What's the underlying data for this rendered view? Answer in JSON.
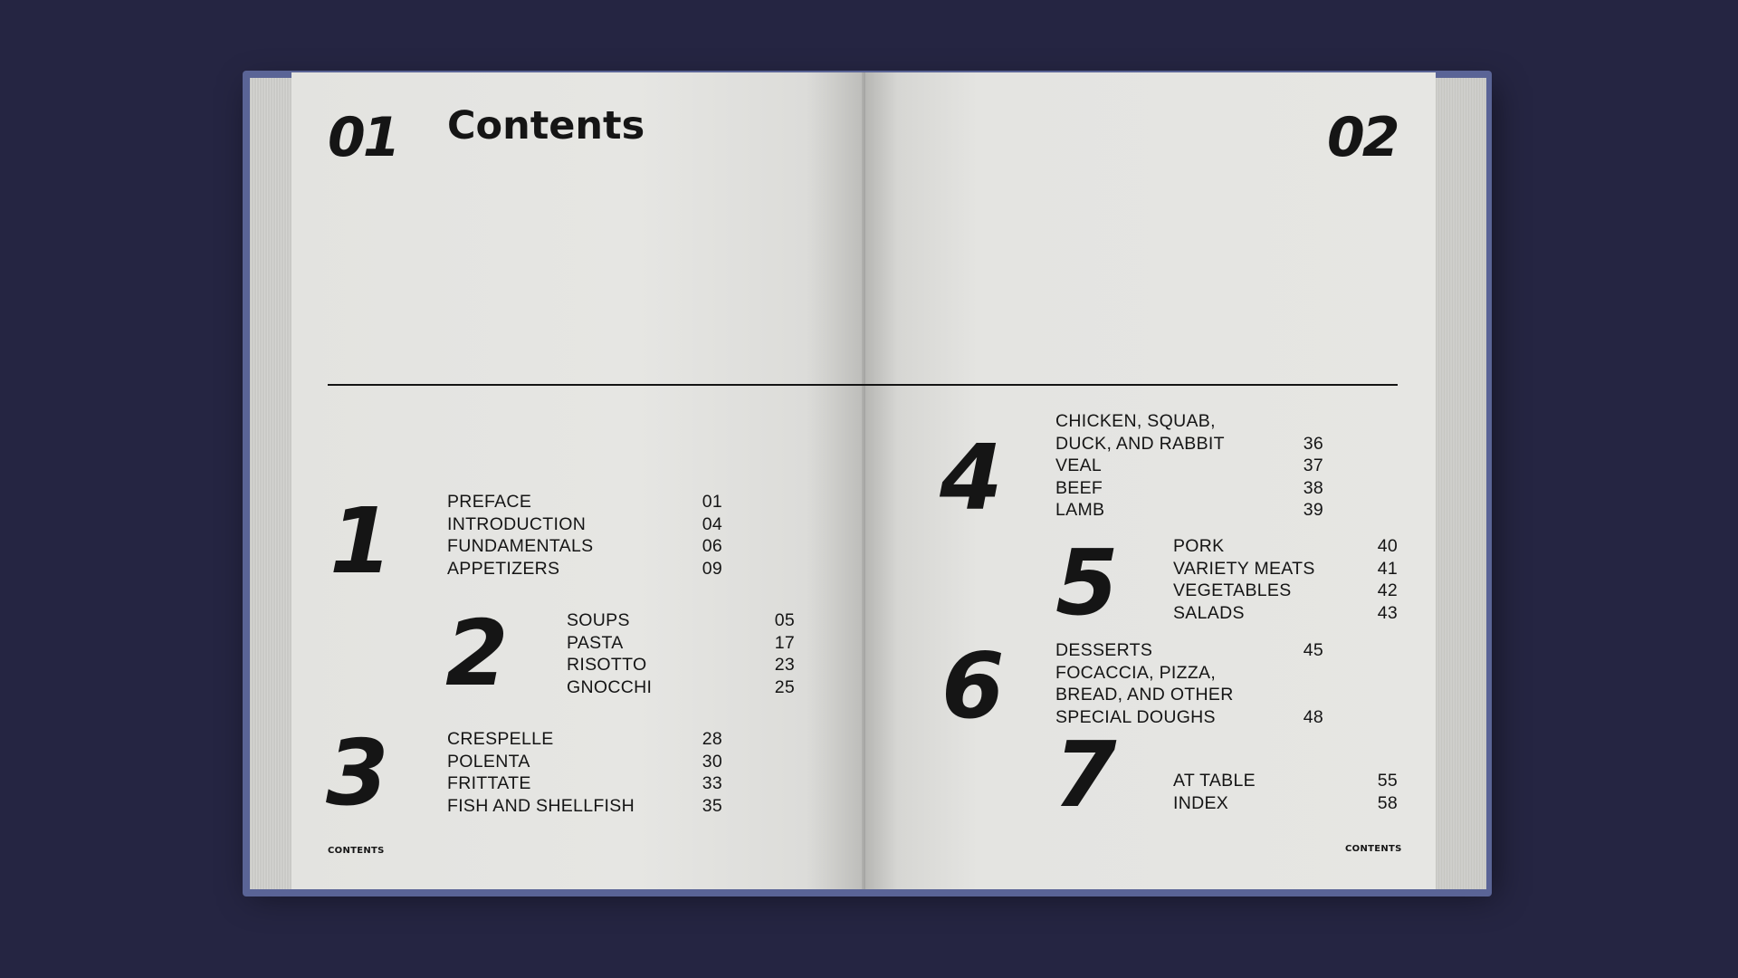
{
  "left_page": {
    "page_number": "01",
    "title": "Contents",
    "footer": "CONTENTS",
    "sections": [
      {
        "number": "1",
        "entries": [
          {
            "label": "PREFACE",
            "page": "01"
          },
          {
            "label": "INTRODUCTION",
            "page": "04"
          },
          {
            "label": "FUNDAMENTALS",
            "page": "06"
          },
          {
            "label": "APPETIZERS",
            "page": "09"
          }
        ]
      },
      {
        "number": "2",
        "entries": [
          {
            "label": "SOUPS",
            "page": "05"
          },
          {
            "label": "PASTA",
            "page": "17"
          },
          {
            "label": "RISOTTO",
            "page": "23"
          },
          {
            "label": "GNOCCHI",
            "page": "25"
          }
        ]
      },
      {
        "number": "3",
        "entries": [
          {
            "label": "CRESPELLE",
            "page": "28"
          },
          {
            "label": "POLENTA",
            "page": "30"
          },
          {
            "label": "FRITTATE",
            "page": "33"
          },
          {
            "label": "FISH AND SHELLFISH",
            "page": "35"
          }
        ]
      }
    ]
  },
  "right_page": {
    "page_number": "02",
    "footer": "CONTENTS",
    "sections": [
      {
        "number": "4",
        "entries": [
          {
            "label": "CHICKEN, SQUAB,",
            "page": ""
          },
          {
            "label": "DUCK, AND RABBIT",
            "page": "36"
          },
          {
            "label": "VEAL",
            "page": "37"
          },
          {
            "label": "BEEF",
            "page": "38"
          },
          {
            "label": "LAMB",
            "page": "39"
          }
        ]
      },
      {
        "number": "5",
        "entries": [
          {
            "label": "PORK",
            "page": "40"
          },
          {
            "label": "VARIETY MEATS",
            "page": "41"
          },
          {
            "label": "VEGETABLES",
            "page": "42"
          },
          {
            "label": "SALADS",
            "page": "43"
          }
        ]
      },
      {
        "number": "6",
        "entries": [
          {
            "label": "DESSERTS",
            "page": "45"
          },
          {
            "label": "FOCACCIA, PIZZA,",
            "page": ""
          },
          {
            "label": "BREAD, AND OTHER",
            "page": ""
          },
          {
            "label": "SPECIAL DOUGHS",
            "page": "48"
          }
        ]
      },
      {
        "number": "7",
        "entries": [
          {
            "label": "AT TABLE",
            "page": "55"
          },
          {
            "label": "INDEX",
            "page": "58"
          }
        ]
      }
    ]
  },
  "colors": {
    "background": "#252542",
    "cover": "#5a6496",
    "paper": "#e5e5e2",
    "ink": "#151515"
  }
}
